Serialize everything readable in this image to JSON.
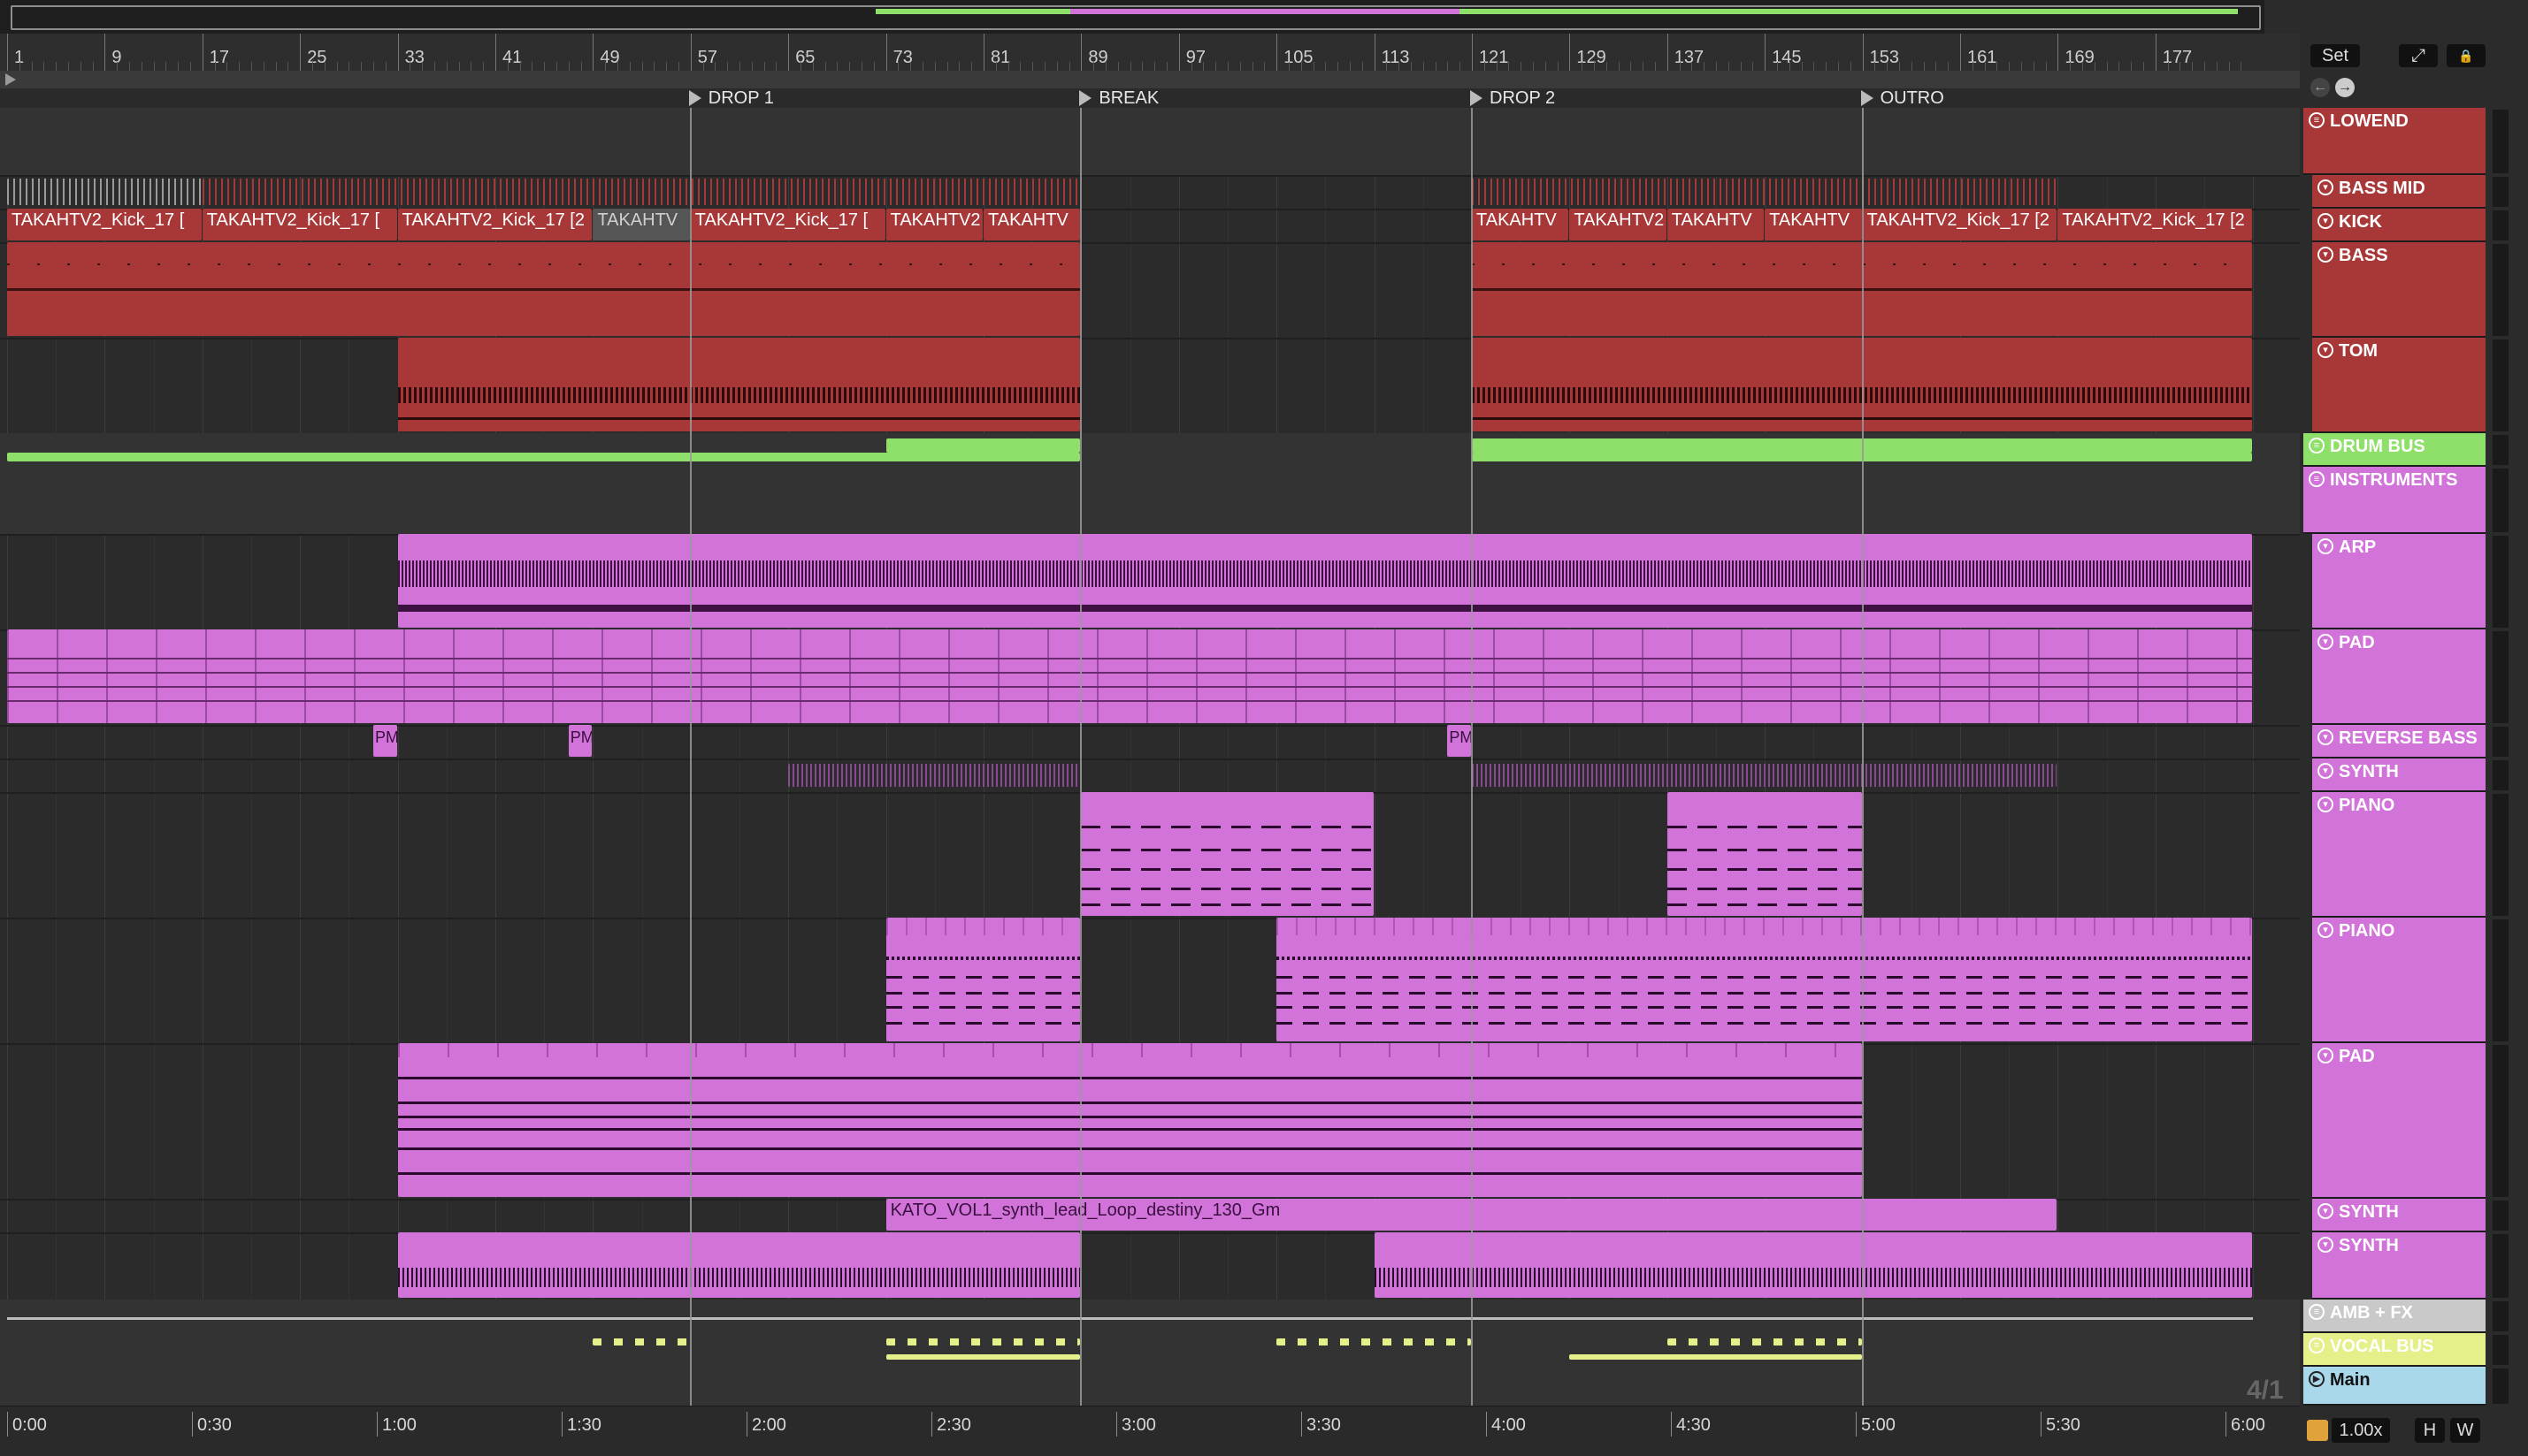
{
  "ruler": {
    "bars": [
      "1",
      "9",
      "17",
      "25",
      "33",
      "41",
      "49",
      "57",
      "65",
      "73",
      "81",
      "89",
      "97",
      "105",
      "113",
      "121",
      "129",
      "137",
      "145",
      "153",
      "161",
      "169",
      "177"
    ]
  },
  "locators": [
    {
      "label": "DROP 1",
      "bar": 57
    },
    {
      "label": "BREAK",
      "bar": 89
    },
    {
      "label": "DROP 2",
      "bar": 121
    },
    {
      "label": "OUTRO",
      "bar": 153
    }
  ],
  "time": [
    "0:00",
    "0:30",
    "1:00",
    "1:30",
    "2:00",
    "2:30",
    "3:00",
    "3:30",
    "4:00",
    "4:30",
    "5:00",
    "5:30",
    "6:00"
  ],
  "kick_clips": [
    {
      "label": "TAKAHTV2_Kick_17 [",
      "start": 1,
      "end": 17
    },
    {
      "label": "TAKAHTV2_Kick_17 [",
      "start": 17,
      "end": 33
    },
    {
      "label": "TAKAHTV2_Kick_17 [2",
      "start": 33,
      "end": 49
    },
    {
      "label": "TAKAHTV",
      "start": 49,
      "end": 57
    },
    {
      "label": "TAKAHTV2_Kick_17 [",
      "start": 57,
      "end": 73
    },
    {
      "label": "TAKAHTV2",
      "start": 73,
      "end": 81
    },
    {
      "label": "TAKAHTV",
      "start": 81,
      "end": 89
    },
    {
      "label": "TAKAHTV",
      "start": 121,
      "end": 129
    },
    {
      "label": "TAKAHTV2",
      "start": 129,
      "end": 137
    },
    {
      "label": "TAKAHTV",
      "start": 137,
      "end": 145
    },
    {
      "label": "TAKAHTV",
      "start": 145,
      "end": 153
    },
    {
      "label": "TAKAHTV2_Kick_17 [2",
      "start": 153,
      "end": 169
    },
    {
      "label": "TAKAHTV2_Kick_17 [2",
      "start": 169,
      "end": 185
    }
  ],
  "synth_clip_label": "KATO_VOL1_synth_lead_Loop_destiny_130_Gm",
  "pm_labels": [
    "PM",
    "PM",
    "PM"
  ],
  "tracks": [
    {
      "name": "LOWEND",
      "kind": "group",
      "color": "#a83838"
    },
    {
      "name": "BASS MID",
      "kind": "track",
      "color": "#a83838"
    },
    {
      "name": "KICK",
      "kind": "track",
      "color": "#a83838"
    },
    {
      "name": "BASS",
      "kind": "track",
      "color": "#a83838"
    },
    {
      "name": "TOM",
      "kind": "track",
      "color": "#a83838"
    },
    {
      "name": "DRUM BUS",
      "kind": "group",
      "color": "#8ee06a"
    },
    {
      "name": "INSTRUMENTS",
      "kind": "group",
      "color": "#d173d9"
    },
    {
      "name": "ARP",
      "kind": "track",
      "color": "#d173d9"
    },
    {
      "name": "PAD",
      "kind": "track",
      "color": "#d173d9"
    },
    {
      "name": "REVERSE BASS",
      "kind": "track",
      "color": "#d173d9"
    },
    {
      "name": "SYNTH",
      "kind": "track",
      "color": "#d173d9"
    },
    {
      "name": "PIANO",
      "kind": "track",
      "color": "#d173d9"
    },
    {
      "name": "PIANO",
      "kind": "track",
      "color": "#d173d9"
    },
    {
      "name": "PAD",
      "kind": "track",
      "color": "#d173d9"
    },
    {
      "name": "SYNTH",
      "kind": "track",
      "color": "#d173d9"
    },
    {
      "name": "SYNTH",
      "kind": "track",
      "color": "#d173d9"
    },
    {
      "name": "AMB + FX",
      "kind": "group",
      "color": "#c9c9c9"
    },
    {
      "name": "VOCAL BUS",
      "kind": "group",
      "color": "#e6f08a"
    },
    {
      "name": "Main",
      "kind": "main",
      "color": "#a9d8ea"
    }
  ],
  "top_buttons": {
    "set": "Set",
    "expand": "⤢",
    "lock": "🔒"
  },
  "bottom": {
    "signature": "4/1",
    "zoom": "1.00x",
    "h": "H",
    "w": "W"
  },
  "colors": {
    "red": "#a83838",
    "pink": "#d173d9",
    "green": "#8ee06a",
    "vocal": "#e6f08a",
    "main": "#a9d8ea"
  }
}
